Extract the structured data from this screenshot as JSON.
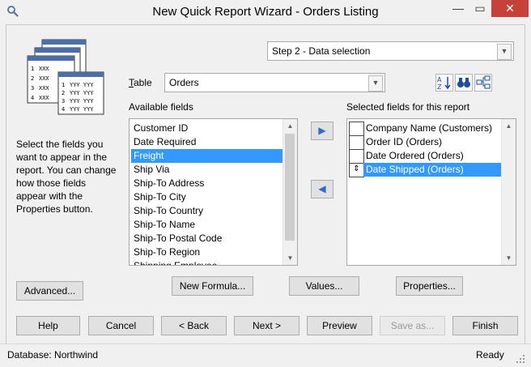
{
  "window": {
    "title": "New Quick Report Wizard - Orders Listing",
    "close_glyph": "✕",
    "maximize_glyph": "▭",
    "minimize_glyph": "—"
  },
  "step_select": {
    "value": "Step 2 - Data selection"
  },
  "table": {
    "label_accel": "T",
    "label_rest": "able",
    "value": "Orders"
  },
  "icon_art_text": {
    "row_numbers": [
      "1",
      "2",
      "3",
      "4"
    ],
    "row_text": "YYY YYY",
    "col_text": "XXX"
  },
  "instructions": "Select the fields you want to appear in the report. You can change how those fields appear with the Properties button.",
  "available_fields": {
    "label": "Available fields",
    "items": [
      "Customer ID",
      "Date Required",
      "Freight",
      "Ship Via",
      "Ship-To Address",
      "Ship-To City",
      "Ship-To Country",
      "Ship-To Name",
      "Ship-To Postal Code",
      "Ship-To Region",
      "Shipping Employee"
    ],
    "selected": "Freight"
  },
  "selected_fields": {
    "label": "Selected fields for this report",
    "items": [
      "Company Name (Customers)",
      "Order ID (Orders)",
      "Date Ordered (Orders)",
      "Date Shipped (Orders)"
    ],
    "selected": "Date Shipped (Orders)"
  },
  "move_buttons": {
    "add": "▶",
    "remove": "◀"
  },
  "tool_icons": {
    "sort": "A↓Z",
    "find": "🔭",
    "tree": "⊞"
  },
  "mid_buttons": {
    "advanced": "Advanced...",
    "new_formula": "New Formula...",
    "values": "Values...",
    "properties": "Properties..."
  },
  "bottom_buttons": {
    "help": "Help",
    "cancel": "Cancel",
    "back": "< Back",
    "next": "Next >",
    "preview": "Preview",
    "save_as": "Save as...",
    "finish": "Finish"
  },
  "status": {
    "database": "Database: Northwind",
    "state": "Ready"
  }
}
